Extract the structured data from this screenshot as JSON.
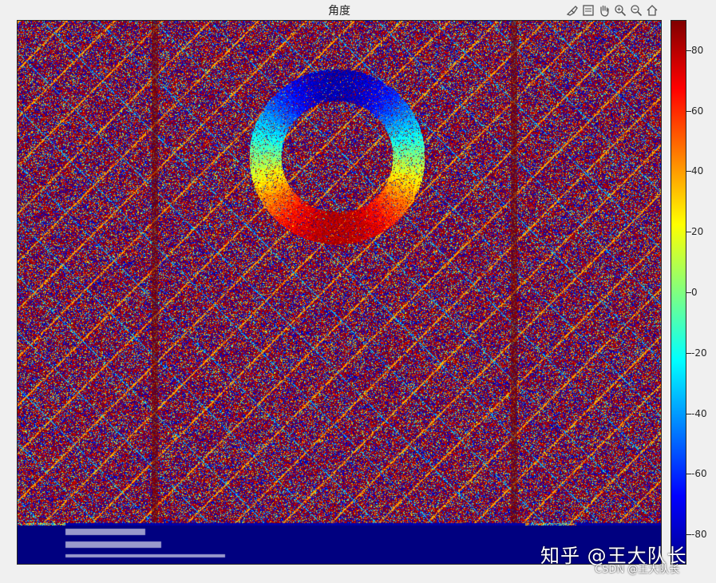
{
  "figure": {
    "title": "角度"
  },
  "toolbar": {
    "items": [
      {
        "name": "brush-icon"
      },
      {
        "name": "datatip-icon"
      },
      {
        "name": "pan-hand-icon"
      },
      {
        "name": "zoom-in-icon"
      },
      {
        "name": "zoom-out-icon"
      },
      {
        "name": "home-icon"
      }
    ]
  },
  "chart_data": {
    "type": "heatmap",
    "title": "角度",
    "colormap": "jet",
    "clim": [
      -90,
      90
    ],
    "colorbar_ticks": [
      "80",
      "60",
      "40",
      "20",
      "0",
      "-20",
      "-40",
      "-60",
      "-80"
    ],
    "colorbar_tick_values": [
      80,
      60,
      40,
      20,
      0,
      -20,
      -40,
      -60,
      -80
    ],
    "grid": false,
    "colorbar_position": "right"
  },
  "watermark": {
    "zhihu": "知乎 @王大队长",
    "csdn": "CSDN @王大队长"
  }
}
